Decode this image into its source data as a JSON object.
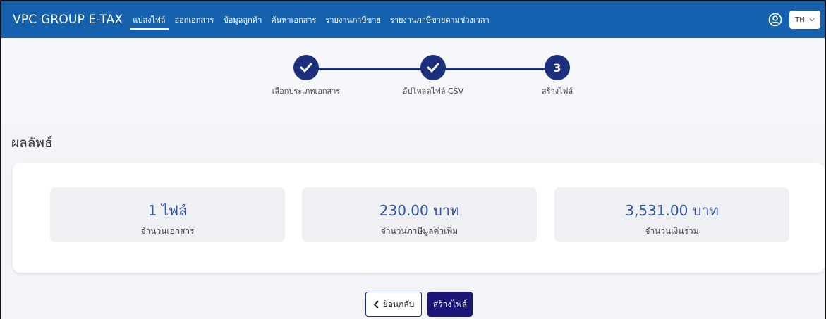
{
  "header": {
    "brand": "VPC GROUP E-TAX",
    "nav": [
      {
        "label": "แปลงไฟล์",
        "active": true
      },
      {
        "label": "ออกเอกสาร"
      },
      {
        "label": "ข้อมูลลูกค้า"
      },
      {
        "label": "ค้นหาเอกสาร"
      },
      {
        "label": "รายงานภาษีขาย"
      },
      {
        "label": "รายงานภาษีขายตามช่วงเวลา"
      }
    ],
    "language": "TH"
  },
  "stepper": {
    "steps": [
      {
        "label": "เลือกประเภทเอกสาร",
        "status": "done"
      },
      {
        "label": "อัปโหลดไฟล์ CSV",
        "status": "done"
      },
      {
        "label": "สร้างไฟล์",
        "number": "3",
        "status": "current"
      }
    ]
  },
  "result": {
    "title": "ผลลัพธ์",
    "stats": [
      {
        "value": "1 ไฟล์",
        "label": "จำนวนเอกสาร"
      },
      {
        "value": "230.00 บาท",
        "label": "จำนวนภาษีมูลค่าเพิ่ม"
      },
      {
        "value": "3,531.00 บาท",
        "label": "จำนวนเงินรวม"
      }
    ]
  },
  "actions": {
    "back_label": "ย้อนกลับ",
    "create_label": "สร้างไฟล์"
  },
  "colors": {
    "topbar": "#1561ad",
    "step_accent": "#1b2f7c",
    "stat_value": "#2f55a8",
    "create_button": "#1a1577"
  }
}
